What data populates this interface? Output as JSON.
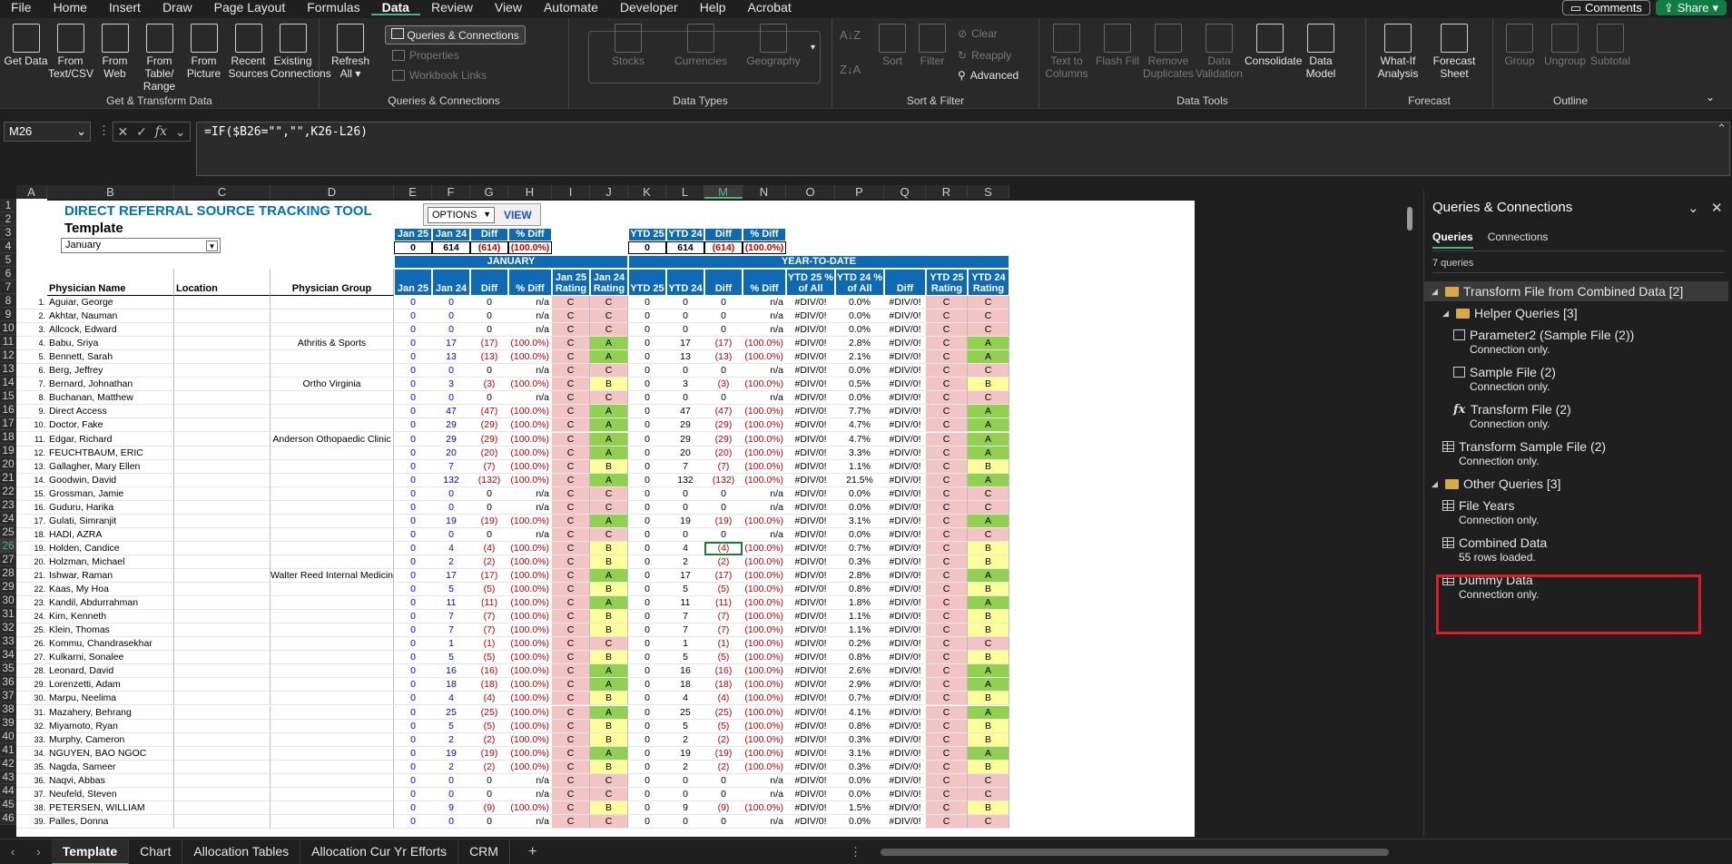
{
  "menu": [
    "File",
    "Home",
    "Insert",
    "Draw",
    "Page Layout",
    "Formulas",
    "Data",
    "Review",
    "View",
    "Automate",
    "Developer",
    "Help",
    "Acrobat"
  ],
  "menu_active": "Data",
  "top_right": {
    "comments": "Comments",
    "share": "Share"
  },
  "ribbon": {
    "get_transform": {
      "label": "Get & Transform Data",
      "buttons": [
        "Get Data",
        "From Text/CSV",
        "From Web",
        "From Table/ Range",
        "From Picture",
        "Recent Sources",
        "Existing Connections"
      ]
    },
    "queries": {
      "label": "Queries & Connections",
      "refresh": "Refresh All",
      "qc": "Queries & Connections",
      "properties": "Properties",
      "workbook_links": "Workbook Links"
    },
    "data_types": {
      "label": "Data Types",
      "items": [
        "Stocks",
        "Currencies",
        "Geography"
      ]
    },
    "sort_filter": {
      "label": "Sort & Filter",
      "sort": "Sort",
      "filter": "Filter",
      "clear": "Clear",
      "reapply": "Reapply",
      "advanced": "Advanced"
    },
    "data_tools": {
      "label": "Data Tools",
      "buttons": [
        "Text to Columns",
        "Flash Fill",
        "Remove Duplicates",
        "Data Validation",
        "Consolidate",
        "Data Model"
      ]
    },
    "forecast": {
      "label": "Forecast",
      "buttons": [
        "What-If Analysis",
        "Forecast Sheet"
      ]
    },
    "outline": {
      "label": "Outline",
      "buttons": [
        "Group",
        "Ungroup",
        "Subtotal"
      ]
    }
  },
  "formula_bar": {
    "name_box": "M26",
    "formula": "=IF($B26=\"\",\"\",K26-L26)"
  },
  "sheet": {
    "title": "DIRECT REFERRAL SOURCE TRACKING TOOL",
    "subtitle": "Template",
    "month": "January",
    "options": "OPTIONS",
    "view": "VIEW",
    "columns": [
      "A",
      "B",
      "C",
      "D",
      "E",
      "F",
      "G",
      "H",
      "I",
      "J",
      "K",
      "L",
      "M",
      "N",
      "O",
      "P",
      "Q",
      "R",
      "S"
    ],
    "selected_col": "M",
    "rows": [
      "1",
      "2",
      "3",
      "4",
      "5",
      "6",
      "7",
      "8",
      "9",
      "10",
      "11",
      "12",
      "13",
      "14",
      "15",
      "16",
      "17",
      "18",
      "19",
      "20",
      "21",
      "22",
      "23",
      "24",
      "25",
      "26",
      "27",
      "28",
      "29",
      "30",
      "31",
      "32",
      "33",
      "34",
      "35",
      "36",
      "37",
      "38",
      "39",
      "40",
      "41",
      "42",
      "43",
      "44",
      "45",
      "46"
    ],
    "selected_row": "26",
    "summary_left": {
      "headers": [
        "Jan 25",
        "Jan 24",
        "Diff",
        "% Diff"
      ],
      "values": [
        "0",
        "614",
        "(614)",
        "(100.0%)"
      ]
    },
    "summary_right": {
      "headers": [
        "YTD 25",
        "YTD 24",
        "Diff",
        "% Diff"
      ],
      "values": [
        "0",
        "614",
        "(614)",
        "(100.0%)"
      ]
    },
    "band_january": "JANUARY",
    "band_ytd": "YEAR-TO-DATE",
    "col_headers": {
      "name": "Physician Name",
      "location": "Location",
      "group": "Physician Group",
      "e": "Jan 25",
      "f": "Jan 24",
      "g": "Diff",
      "h": "% Diff",
      "i": "Jan 25 Rating",
      "j": "Jan 24 Rating",
      "k": "YTD 25",
      "l": "YTD 24",
      "m": "Diff",
      "n": "% Diff",
      "o": "YTD 25 % of All",
      "p": "YTD 24 % of All",
      "q": "Diff",
      "r": "YTD 25 Rating",
      "s": "YTD 24 Rating"
    },
    "data": [
      [
        "1.",
        "Aguiar, George",
        "",
        "",
        "0",
        "0",
        "0",
        "n/a",
        "C",
        "C",
        "0",
        "0",
        "0",
        "n/a",
        "#DIV/0!",
        "0.0%",
        "#DIV/0!",
        "C",
        "C"
      ],
      [
        "2.",
        "Akhtar, Nauman",
        "",
        "",
        "0",
        "0",
        "0",
        "n/a",
        "C",
        "C",
        "0",
        "0",
        "0",
        "n/a",
        "#DIV/0!",
        "0.0%",
        "#DIV/0!",
        "C",
        "C"
      ],
      [
        "3.",
        "Allcock, Edward",
        "",
        "",
        "0",
        "0",
        "0",
        "n/a",
        "C",
        "C",
        "0",
        "0",
        "0",
        "n/a",
        "#DIV/0!",
        "0.0%",
        "#DIV/0!",
        "C",
        "C"
      ],
      [
        "4.",
        "Babu, Sriya",
        "",
        "Athritis & Sports",
        "0",
        "17",
        "(17)",
        "(100.0%)",
        "C",
        "A",
        "0",
        "17",
        "(17)",
        "(100.0%)",
        "#DIV/0!",
        "2.8%",
        "#DIV/0!",
        "C",
        "A"
      ],
      [
        "5.",
        "Bennett, Sarah",
        "",
        "",
        "0",
        "13",
        "(13)",
        "(100.0%)",
        "C",
        "A",
        "0",
        "13",
        "(13)",
        "(100.0%)",
        "#DIV/0!",
        "2.1%",
        "#DIV/0!",
        "C",
        "A"
      ],
      [
        "6.",
        "Berg, Jeffrey",
        "",
        "",
        "0",
        "0",
        "0",
        "n/a",
        "C",
        "C",
        "0",
        "0",
        "0",
        "n/a",
        "#DIV/0!",
        "0.0%",
        "#DIV/0!",
        "C",
        "C"
      ],
      [
        "7.",
        "Bernard, Johnathan",
        "",
        "Ortho Virginia",
        "0",
        "3",
        "(3)",
        "(100.0%)",
        "C",
        "B",
        "0",
        "3",
        "(3)",
        "(100.0%)",
        "#DIV/0!",
        "0.5%",
        "#DIV/0!",
        "C",
        "B"
      ],
      [
        "8.",
        "Buchanan, Matthew",
        "",
        "",
        "0",
        "0",
        "0",
        "n/a",
        "C",
        "C",
        "0",
        "0",
        "0",
        "n/a",
        "#DIV/0!",
        "0.0%",
        "#DIV/0!",
        "C",
        "C"
      ],
      [
        "9.",
        "Direct Access",
        "",
        "",
        "0",
        "47",
        "(47)",
        "(100.0%)",
        "C",
        "A",
        "0",
        "47",
        "(47)",
        "(100.0%)",
        "#DIV/0!",
        "7.7%",
        "#DIV/0!",
        "C",
        "A"
      ],
      [
        "10.",
        "Doctor, Fake",
        "",
        "",
        "0",
        "29",
        "(29)",
        "(100.0%)",
        "C",
        "A",
        "0",
        "29",
        "(29)",
        "(100.0%)",
        "#DIV/0!",
        "4.7%",
        "#DIV/0!",
        "C",
        "A"
      ],
      [
        "11.",
        "Edgar, Richard",
        "",
        "Anderson Othopaedic Clinic",
        "0",
        "29",
        "(29)",
        "(100.0%)",
        "C",
        "A",
        "0",
        "29",
        "(29)",
        "(100.0%)",
        "#DIV/0!",
        "4.7%",
        "#DIV/0!",
        "C",
        "A"
      ],
      [
        "12.",
        "FEUCHTBAUM, ERIC",
        "",
        "",
        "0",
        "20",
        "(20)",
        "(100.0%)",
        "C",
        "A",
        "0",
        "20",
        "(20)",
        "(100.0%)",
        "#DIV/0!",
        "3.3%",
        "#DIV/0!",
        "C",
        "A"
      ],
      [
        "13.",
        "Gallagher, Mary Ellen",
        "",
        "",
        "0",
        "7",
        "(7)",
        "(100.0%)",
        "C",
        "B",
        "0",
        "7",
        "(7)",
        "(100.0%)",
        "#DIV/0!",
        "1.1%",
        "#DIV/0!",
        "C",
        "B"
      ],
      [
        "14.",
        "Goodwin, David",
        "",
        "",
        "0",
        "132",
        "(132)",
        "(100.0%)",
        "C",
        "A",
        "0",
        "132",
        "(132)",
        "(100.0%)",
        "#DIV/0!",
        "21.5%",
        "#DIV/0!",
        "C",
        "A"
      ],
      [
        "15.",
        "Grossman, Jamie",
        "",
        "",
        "0",
        "0",
        "0",
        "n/a",
        "C",
        "C",
        "0",
        "0",
        "0",
        "n/a",
        "#DIV/0!",
        "0.0%",
        "#DIV/0!",
        "C",
        "C"
      ],
      [
        "16.",
        "Guduru, Harika",
        "",
        "",
        "0",
        "0",
        "0",
        "n/a",
        "C",
        "C",
        "0",
        "0",
        "0",
        "n/a",
        "#DIV/0!",
        "0.0%",
        "#DIV/0!",
        "C",
        "C"
      ],
      [
        "17.",
        "Gulati, Simranjit",
        "",
        "",
        "0",
        "19",
        "(19)",
        "(100.0%)",
        "C",
        "A",
        "0",
        "19",
        "(19)",
        "(100.0%)",
        "#DIV/0!",
        "3.1%",
        "#DIV/0!",
        "C",
        "A"
      ],
      [
        "18.",
        "HADI, AZRA",
        "",
        "",
        "0",
        "0",
        "0",
        "n/a",
        "C",
        "C",
        "0",
        "0",
        "0",
        "n/a",
        "#DIV/0!",
        "0.0%",
        "#DIV/0!",
        "C",
        "C"
      ],
      [
        "19.",
        "Holden, Candice",
        "",
        "",
        "0",
        "4",
        "(4)",
        "(100.0%)",
        "C",
        "B",
        "0",
        "4",
        "(4)",
        "(100.0%)",
        "#DIV/0!",
        "0.7%",
        "#DIV/0!",
        "C",
        "B"
      ],
      [
        "20.",
        "Holzman, Michael",
        "",
        "",
        "0",
        "2",
        "(2)",
        "(100.0%)",
        "C",
        "B",
        "0",
        "2",
        "(2)",
        "(100.0%)",
        "#DIV/0!",
        "0.3%",
        "#DIV/0!",
        "C",
        "B"
      ],
      [
        "21.",
        "Ishwar, Raman",
        "",
        "Walter Reed Internal Medicine Clinic",
        "0",
        "17",
        "(17)",
        "(100.0%)",
        "C",
        "A",
        "0",
        "17",
        "(17)",
        "(100.0%)",
        "#DIV/0!",
        "2.8%",
        "#DIV/0!",
        "C",
        "A"
      ],
      [
        "22.",
        "Kaas, My Hoa",
        "",
        "",
        "0",
        "5",
        "(5)",
        "(100.0%)",
        "C",
        "B",
        "0",
        "5",
        "(5)",
        "(100.0%)",
        "#DIV/0!",
        "0.8%",
        "#DIV/0!",
        "C",
        "B"
      ],
      [
        "23.",
        "Kandil, Abdurrahman",
        "",
        "",
        "0",
        "11",
        "(11)",
        "(100.0%)",
        "C",
        "A",
        "0",
        "11",
        "(11)",
        "(100.0%)",
        "#DIV/0!",
        "1.8%",
        "#DIV/0!",
        "C",
        "A"
      ],
      [
        "24.",
        "Kim, Kenneth",
        "",
        "",
        "0",
        "7",
        "(7)",
        "(100.0%)",
        "C",
        "B",
        "0",
        "7",
        "(7)",
        "(100.0%)",
        "#DIV/0!",
        "1.1%",
        "#DIV/0!",
        "C",
        "B"
      ],
      [
        "25.",
        "Klein, Thomas",
        "",
        "",
        "0",
        "7",
        "(7)",
        "(100.0%)",
        "C",
        "B",
        "0",
        "7",
        "(7)",
        "(100.0%)",
        "#DIV/0!",
        "1.1%",
        "#DIV/0!",
        "C",
        "B"
      ],
      [
        "26.",
        "Kommu, Chandrasekhar",
        "",
        "",
        "0",
        "1",
        "(1)",
        "(100.0%)",
        "C",
        "C",
        "0",
        "1",
        "(1)",
        "(100.0%)",
        "#DIV/0!",
        "0.2%",
        "#DIV/0!",
        "C",
        "C"
      ],
      [
        "27.",
        "Kulkarni, Sonalee",
        "",
        "",
        "0",
        "5",
        "(5)",
        "(100.0%)",
        "C",
        "B",
        "0",
        "5",
        "(5)",
        "(100.0%)",
        "#DIV/0!",
        "0.8%",
        "#DIV/0!",
        "C",
        "B"
      ],
      [
        "28.",
        "Leonard, David",
        "",
        "",
        "0",
        "16",
        "(16)",
        "(100.0%)",
        "C",
        "A",
        "0",
        "16",
        "(16)",
        "(100.0%)",
        "#DIV/0!",
        "2.6%",
        "#DIV/0!",
        "C",
        "A"
      ],
      [
        "29.",
        "Lorenzetti, Adam",
        "",
        "",
        "0",
        "18",
        "(18)",
        "(100.0%)",
        "C",
        "A",
        "0",
        "18",
        "(18)",
        "(100.0%)",
        "#DIV/0!",
        "2.9%",
        "#DIV/0!",
        "C",
        "A"
      ],
      [
        "30.",
        "Marpu, Neelima",
        "",
        "",
        "0",
        "4",
        "(4)",
        "(100.0%)",
        "C",
        "B",
        "0",
        "4",
        "(4)",
        "(100.0%)",
        "#DIV/0!",
        "0.7%",
        "#DIV/0!",
        "C",
        "B"
      ],
      [
        "31.",
        "Mazahery, Behrang",
        "",
        "",
        "0",
        "25",
        "(25)",
        "(100.0%)",
        "C",
        "A",
        "0",
        "25",
        "(25)",
        "(100.0%)",
        "#DIV/0!",
        "4.1%",
        "#DIV/0!",
        "C",
        "A"
      ],
      [
        "32.",
        "Miyamoto, Ryan",
        "",
        "",
        "0",
        "5",
        "(5)",
        "(100.0%)",
        "C",
        "B",
        "0",
        "5",
        "(5)",
        "(100.0%)",
        "#DIV/0!",
        "0.8%",
        "#DIV/0!",
        "C",
        "B"
      ],
      [
        "33.",
        "Murphy, Cameron",
        "",
        "",
        "0",
        "2",
        "(2)",
        "(100.0%)",
        "C",
        "B",
        "0",
        "2",
        "(2)",
        "(100.0%)",
        "#DIV/0!",
        "0.3%",
        "#DIV/0!",
        "C",
        "B"
      ],
      [
        "34.",
        "NGUYEN, BAO NGOC",
        "",
        "",
        "0",
        "19",
        "(19)",
        "(100.0%)",
        "C",
        "A",
        "0",
        "19",
        "(19)",
        "(100.0%)",
        "#DIV/0!",
        "3.1%",
        "#DIV/0!",
        "C",
        "A"
      ],
      [
        "35.",
        "Nagda, Sameer",
        "",
        "",
        "0",
        "2",
        "(2)",
        "(100.0%)",
        "C",
        "B",
        "0",
        "2",
        "(2)",
        "(100.0%)",
        "#DIV/0!",
        "0.3%",
        "#DIV/0!",
        "C",
        "B"
      ],
      [
        "36.",
        "Naqvi, Abbas",
        "",
        "",
        "0",
        "0",
        "0",
        "n/a",
        "C",
        "C",
        "0",
        "0",
        "0",
        "n/a",
        "#DIV/0!",
        "0.0%",
        "#DIV/0!",
        "C",
        "C"
      ],
      [
        "37.",
        "Neufeld, Steven",
        "",
        "",
        "0",
        "0",
        "0",
        "n/a",
        "C",
        "C",
        "0",
        "0",
        "0",
        "n/a",
        "#DIV/0!",
        "0.0%",
        "#DIV/0!",
        "C",
        "C"
      ],
      [
        "38.",
        "PETERSEN, WILLIAM",
        "",
        "",
        "0",
        "9",
        "(9)",
        "(100.0%)",
        "C",
        "B",
        "0",
        "9",
        "(9)",
        "(100.0%)",
        "#DIV/0!",
        "1.5%",
        "#DIV/0!",
        "C",
        "B"
      ],
      [
        "39.",
        "Palles, Donna",
        "",
        "",
        "0",
        "0",
        "0",
        "n/a",
        "C",
        "C",
        "0",
        "0",
        "0",
        "n/a",
        "#DIV/0!",
        "0.0%",
        "#DIV/0!",
        "C",
        "C"
      ]
    ]
  },
  "sheet_tabs": [
    "Template",
    "Chart",
    "Allocation Tables",
    "Allocation Cur Yr Efforts",
    "CRM"
  ],
  "active_sheet": "Template",
  "pane": {
    "title": "Queries & Connections",
    "tabs": [
      "Queries",
      "Connections"
    ],
    "count": "7 queries",
    "tree": [
      {
        "label": "Transform File from Combined Data [2]",
        "kind": "folder",
        "level": 0
      },
      {
        "label": "Helper Queries [3]",
        "kind": "folder",
        "level": 1
      },
      {
        "label": "Parameter2 (Sample File (2))",
        "sub": "Connection only.",
        "kind": "param",
        "level": 2
      },
      {
        "label": "Sample File (2)",
        "sub": "Connection only.",
        "kind": "param",
        "level": 2
      },
      {
        "label": "Transform File (2)",
        "sub": "Connection only.",
        "kind": "fx",
        "level": 2
      },
      {
        "label": "Transform Sample File (2)",
        "sub": "Connection only.",
        "kind": "table",
        "level": 1
      },
      {
        "label": "Other Queries [3]",
        "kind": "folder",
        "level": 0
      },
      {
        "label": "File Years",
        "sub": "Connection only.",
        "kind": "table",
        "level": 1
      },
      {
        "label": "Combined Data",
        "sub": "55 rows loaded.",
        "kind": "table",
        "level": 1
      },
      {
        "label": "Dummy Data",
        "sub": "Connection only.",
        "kind": "table",
        "level": 1
      }
    ]
  },
  "colors": {
    "accent": "#4fb37c",
    "header_blue": "#0f6ab5",
    "rating_a": "#92d050",
    "rating_b": "#ffff99",
    "rating_c": "#f2c4c4",
    "highlight": "#e11b22"
  }
}
